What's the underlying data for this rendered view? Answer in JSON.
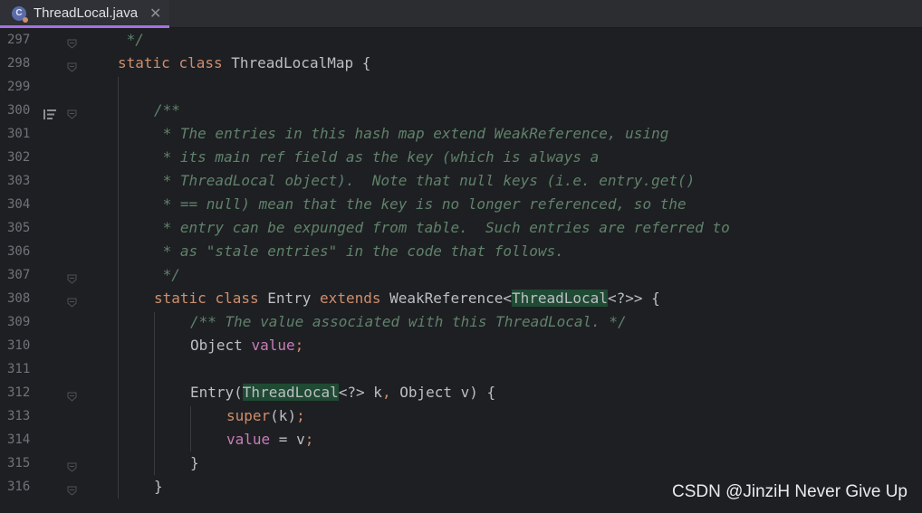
{
  "tab": {
    "title": "ThreadLocal.java",
    "icon_letter": "C",
    "close_glyph": "✕"
  },
  "lines": [
    {
      "num": "297",
      "indent": 1,
      "parts": [
        {
          "t": " */",
          "c": "cm"
        }
      ]
    },
    {
      "num": "298",
      "indent": 1,
      "parts": [
        {
          "t": "static",
          "c": "kw"
        },
        {
          "t": " "
        },
        {
          "t": "class",
          "c": "kw"
        },
        {
          "t": " ThreadLocalMap {"
        }
      ]
    },
    {
      "num": "299",
      "indent": 1,
      "parts": []
    },
    {
      "num": "300",
      "indent": 2,
      "parts": [
        {
          "t": "/**",
          "c": "cm"
        }
      ]
    },
    {
      "num": "301",
      "indent": 2,
      "parts": [
        {
          "t": " * The entries in this hash map extend WeakReference, using",
          "c": "cm"
        }
      ]
    },
    {
      "num": "302",
      "indent": 2,
      "parts": [
        {
          "t": " * its main ref field as the key (which is always a",
          "c": "cm"
        }
      ]
    },
    {
      "num": "303",
      "indent": 2,
      "parts": [
        {
          "t": " * ThreadLocal object).  Note that null keys (i.e. entry.get()",
          "c": "cm"
        }
      ]
    },
    {
      "num": "304",
      "indent": 2,
      "parts": [
        {
          "t": " * == null) mean that the key is no longer referenced, so the",
          "c": "cm"
        }
      ]
    },
    {
      "num": "305",
      "indent": 2,
      "parts": [
        {
          "t": " * entry can be expunged from table.  Such entries are referred to",
          "c": "cm"
        }
      ]
    },
    {
      "num": "306",
      "indent": 2,
      "parts": [
        {
          "t": " * as \"stale entries\" in the code that follows.",
          "c": "cm"
        }
      ]
    },
    {
      "num": "307",
      "indent": 2,
      "parts": [
        {
          "t": " */",
          "c": "cm"
        }
      ]
    },
    {
      "num": "308",
      "indent": 2,
      "parts": [
        {
          "t": "static",
          "c": "kw"
        },
        {
          "t": " "
        },
        {
          "t": "class",
          "c": "kw"
        },
        {
          "t": " Entry "
        },
        {
          "t": "extends",
          "c": "kw"
        },
        {
          "t": " WeakReference<"
        },
        {
          "t": "ThreadLocal",
          "c": "hl"
        },
        {
          "t": "<?>> {"
        }
      ]
    },
    {
      "num": "309",
      "indent": 3,
      "parts": [
        {
          "t": "/** The value associated with this ThreadLocal. */",
          "c": "cm"
        }
      ]
    },
    {
      "num": "310",
      "indent": 3,
      "parts": [
        {
          "t": "Object "
        },
        {
          "t": "value",
          "c": "fld"
        },
        {
          "t": ";",
          "c": "kw"
        }
      ]
    },
    {
      "num": "311",
      "indent": 3,
      "parts": []
    },
    {
      "num": "312",
      "indent": 3,
      "parts": [
        {
          "t": "Entry("
        },
        {
          "t": "ThreadLocal",
          "c": "hl"
        },
        {
          "t": "<?> k"
        },
        {
          "t": ",",
          "c": "kw"
        },
        {
          "t": " Object v) {"
        }
      ]
    },
    {
      "num": "313",
      "indent": 4,
      "parts": [
        {
          "t": "super",
          "c": "kw"
        },
        {
          "t": "(k)"
        },
        {
          "t": ";",
          "c": "kw"
        }
      ]
    },
    {
      "num": "314",
      "indent": 4,
      "parts": [
        {
          "t": "value",
          "c": "fld"
        },
        {
          "t": " = v"
        },
        {
          "t": ";",
          "c": "kw"
        }
      ]
    },
    {
      "num": "315",
      "indent": 3,
      "parts": [
        {
          "t": "}"
        }
      ]
    },
    {
      "num": "316",
      "indent": 2,
      "parts": [
        {
          "t": "}"
        }
      ]
    }
  ],
  "gutter": {
    "fold_icons": [
      "297",
      "298",
      "300",
      "307",
      "308",
      "312",
      "315",
      "316"
    ],
    "reader_mode_icon_line": "300"
  },
  "watermark": "CSDN @JinziH Never Give Up",
  "colors": {
    "background": "#1e1f22",
    "keyword": "#cf8e6d",
    "comment": "#5f826b",
    "field": "#c77dbb",
    "text": "#bcbec4",
    "highlight": "#1f4a33",
    "tab_accent": "#a571e6"
  }
}
